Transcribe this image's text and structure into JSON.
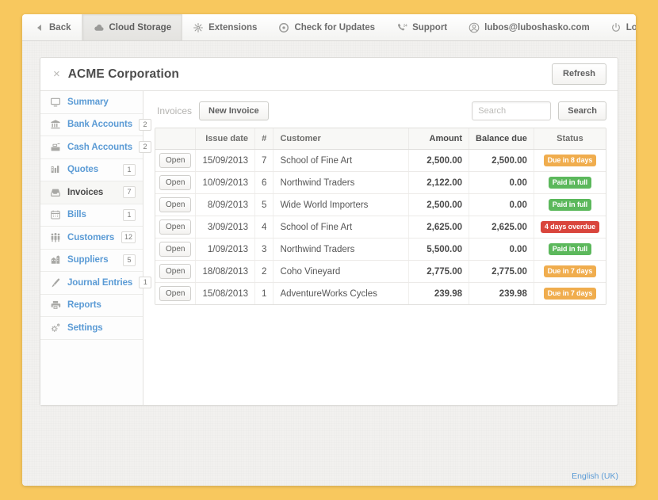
{
  "topbar": {
    "left_items": [
      {
        "label": "Back",
        "icon": "back-arrow-icon",
        "state": "normal"
      },
      {
        "label": "Cloud Storage",
        "icon": "cloud-icon",
        "state": "active"
      },
      {
        "label": "Extensions",
        "icon": "extensions-icon",
        "state": "normal"
      },
      {
        "label": "Check for Updates",
        "icon": "refresh-circle-icon",
        "state": "normal"
      },
      {
        "label": "Support",
        "icon": "support-phone-icon",
        "state": "normal"
      }
    ],
    "account_email": "lubos@luboshasko.com",
    "logout_label": "Logout"
  },
  "panel": {
    "title": "ACME Corporation",
    "close_label": "×",
    "refresh_label": "Refresh"
  },
  "sidebar": {
    "items": [
      {
        "label": "Summary",
        "icon": "monitor-icon",
        "count": "",
        "active": false
      },
      {
        "label": "Bank Accounts",
        "icon": "bank-icon",
        "count": "2",
        "active": false
      },
      {
        "label": "Cash Accounts",
        "icon": "cash-register-icon",
        "count": "2",
        "active": false
      },
      {
        "label": "Quotes",
        "icon": "quote-chart-icon",
        "count": "1",
        "active": false
      },
      {
        "label": "Invoices",
        "icon": "inbox-icon",
        "count": "7",
        "active": true
      },
      {
        "label": "Bills",
        "icon": "calendar-icon",
        "count": "1",
        "active": false
      },
      {
        "label": "Customers",
        "icon": "people-icon",
        "count": "12",
        "active": false
      },
      {
        "label": "Suppliers",
        "icon": "buildings-icon",
        "count": "5",
        "active": false
      },
      {
        "label": "Journal Entries",
        "icon": "pen-icon",
        "count": "1",
        "active": false
      },
      {
        "label": "Reports",
        "icon": "printer-icon",
        "count": "",
        "active": false
      },
      {
        "label": "Settings",
        "icon": "gears-icon",
        "count": "",
        "active": false
      }
    ]
  },
  "content_toolbar": {
    "section_label": "Invoices",
    "new_invoice_label": "New Invoice",
    "search_placeholder": "Search",
    "search_value": "",
    "search_button_label": "Search"
  },
  "table": {
    "columns": [
      "",
      "Issue date",
      "#",
      "Customer",
      "Amount",
      "Balance due",
      "Status"
    ],
    "open_label": "Open",
    "rows": [
      {
        "issue_date": "15/09/2013",
        "number": "7",
        "customer": "School of Fine Art",
        "amount": "2,500.00",
        "balance_due": "2,500.00",
        "status": "Due in 8 days",
        "status_type": "due"
      },
      {
        "issue_date": "10/09/2013",
        "number": "6",
        "customer": "Northwind Traders",
        "amount": "2,122.00",
        "balance_due": "0.00",
        "status": "Paid in full",
        "status_type": "paid"
      },
      {
        "issue_date": "8/09/2013",
        "number": "5",
        "customer": "Wide World Importers",
        "amount": "2,500.00",
        "balance_due": "0.00",
        "status": "Paid in full",
        "status_type": "paid"
      },
      {
        "issue_date": "3/09/2013",
        "number": "4",
        "customer": "School of Fine Art",
        "amount": "2,625.00",
        "balance_due": "2,625.00",
        "status": "4 days overdue",
        "status_type": "overdue"
      },
      {
        "issue_date": "1/09/2013",
        "number": "3",
        "customer": "Northwind Traders",
        "amount": "5,500.00",
        "balance_due": "0.00",
        "status": "Paid in full",
        "status_type": "paid"
      },
      {
        "issue_date": "18/08/2013",
        "number": "2",
        "customer": "Coho Vineyard",
        "amount": "2,775.00",
        "balance_due": "2,775.00",
        "status": "Due in 7 days",
        "status_type": "due"
      },
      {
        "issue_date": "15/08/2013",
        "number": "1",
        "customer": "AdventureWorks Cycles",
        "amount": "239.98",
        "balance_due": "239.98",
        "status": "Due in 7 days",
        "status_type": "due"
      }
    ]
  },
  "footer": {
    "language_label": "English (UK)"
  },
  "colors": {
    "page_background": "#f8c85e",
    "window_background": "#f2f1ef",
    "link": "#5b9bd5",
    "status_due": "#f0ad4e",
    "status_paid": "#5cb85c",
    "status_overdue": "#d9453c"
  }
}
